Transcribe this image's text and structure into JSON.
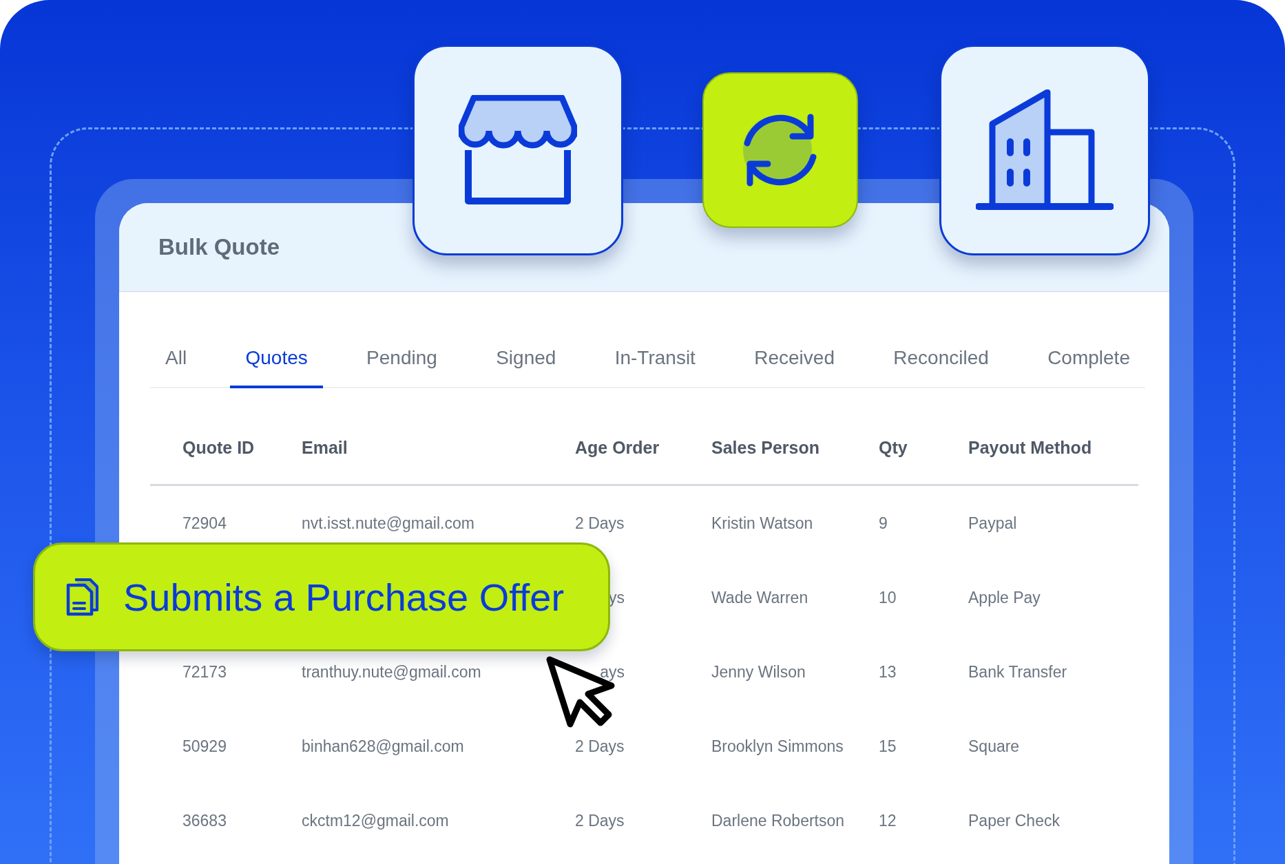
{
  "card": {
    "title": "Bulk Quote"
  },
  "tabs": [
    {
      "label": "All",
      "selected": false
    },
    {
      "label": "Quotes",
      "selected": true
    },
    {
      "label": "Pending",
      "selected": false
    },
    {
      "label": "Signed",
      "selected": false
    },
    {
      "label": "In-Transit",
      "selected": false
    },
    {
      "label": "Received",
      "selected": false
    },
    {
      "label": "Reconciled",
      "selected": false
    },
    {
      "label": "Complete",
      "selected": false
    }
  ],
  "table": {
    "columns": [
      "Quote ID",
      "Email",
      "Age Order",
      "Sales Person",
      "Qty",
      "Payout Method"
    ],
    "rows": [
      {
        "covered": false,
        "cells": [
          "72904",
          "nvt.isst.nute@gmail.com",
          "2 Days",
          "Kristin Watson",
          "9",
          "Paypal"
        ]
      },
      {
        "covered": true,
        "cells": [
          null,
          null,
          "ys",
          "Wade Warren",
          "10",
          "Apple Pay"
        ]
      },
      {
        "covered": true,
        "cells": [
          "72173",
          "tranthuy.nute@gmail.com",
          "ays",
          "Jenny Wilson",
          "13",
          "Bank Transfer"
        ]
      },
      {
        "covered": false,
        "cells": [
          "50929",
          "binhan628@gmail.com",
          "2 Days",
          "Brooklyn Simmons",
          "15",
          "Square"
        ]
      },
      {
        "covered": false,
        "cells": [
          "36683",
          "ckctm12@gmail.com",
          "2 Days",
          "Darlene Robertson",
          "12",
          "Paper Check"
        ]
      }
    ]
  },
  "callout": {
    "label": "Submits a Purchase Offer"
  }
}
